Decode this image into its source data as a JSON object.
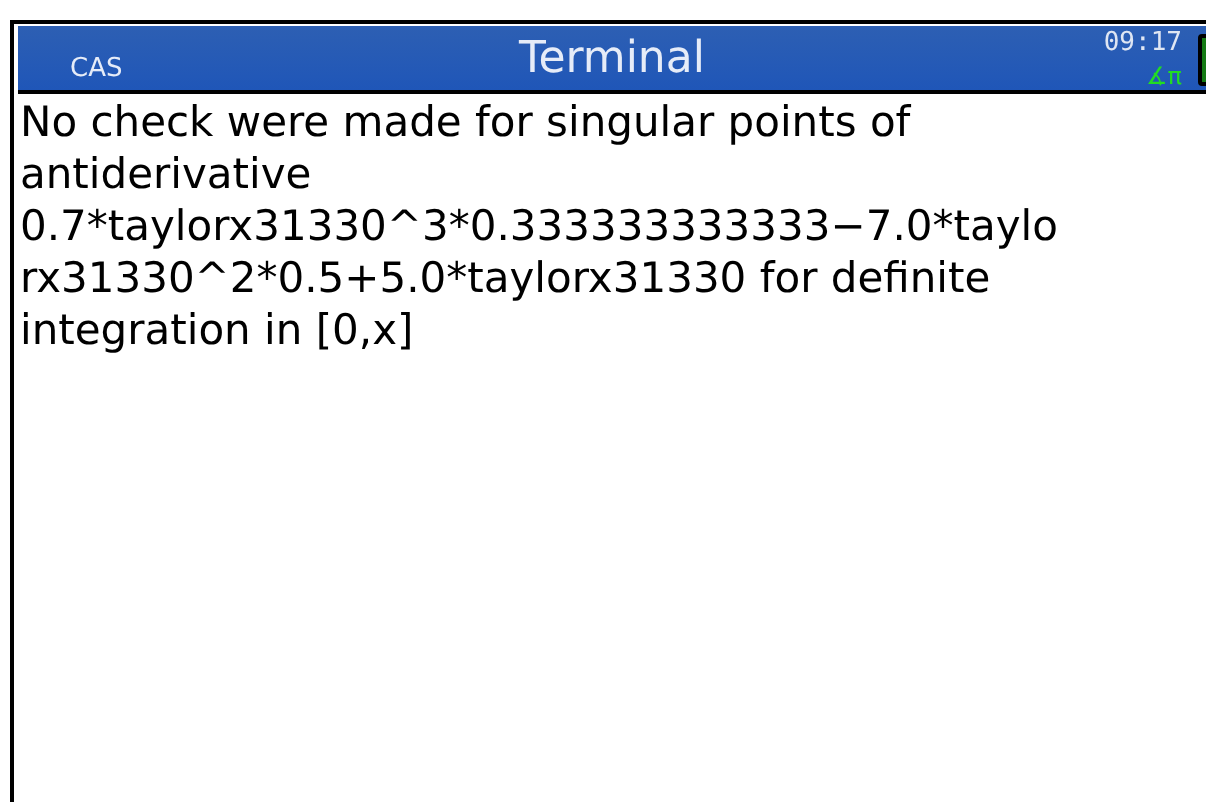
{
  "header": {
    "mode": "CAS",
    "title": "Terminal",
    "time": "09:17",
    "angle_indicator": "∡π"
  },
  "output": {
    "lines": [
      "No check were made for singular points of",
      "antiderivative",
      "0.7*taylorx31330^3*0.333333333333−7.0*taylo",
      "rx31330^2*0.5+5.0*taylorx31330 for definite",
      "integration in [0,x]"
    ]
  }
}
